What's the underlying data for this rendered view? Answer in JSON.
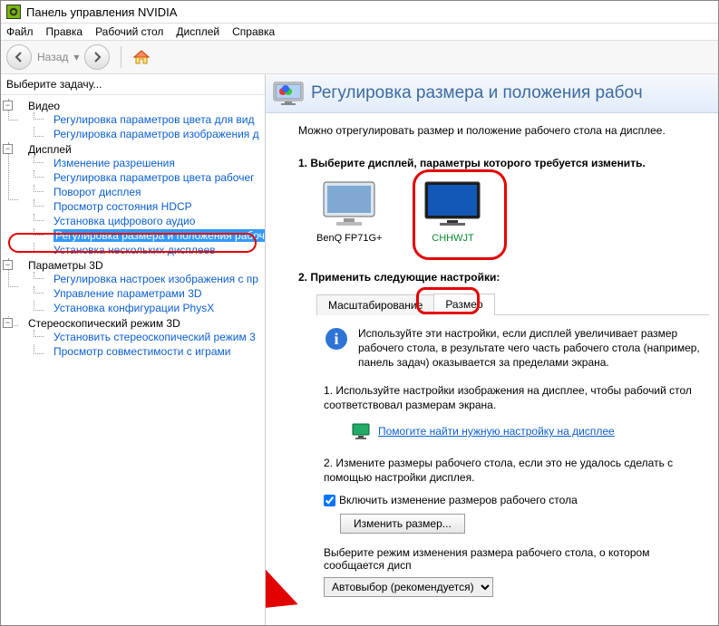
{
  "titlebar": {
    "title": "Панель управления NVIDIA"
  },
  "menu": {
    "file": "Файл",
    "edit": "Правка",
    "desktop": "Рабочий стол",
    "display": "Дисплей",
    "help": "Справка"
  },
  "toolbar": {
    "back": "Назад"
  },
  "sidebar": {
    "select_task": "Выберите задачу...",
    "video": {
      "label": "Видео",
      "items": [
        "Регулировка параметров цвета для вид",
        "Регулировка параметров изображения д"
      ]
    },
    "display": {
      "label": "Дисплей",
      "items": [
        "Изменение разрешения",
        "Регулировка параметров цвета рабочег",
        "Поворот дисплея",
        "Просмотр состояния HDCP",
        "Установка цифрового аудио",
        "Регулировка размера и положения рабоч",
        "Установка нескольких дисплеев"
      ]
    },
    "params3d": {
      "label": "Параметры 3D",
      "items": [
        "Регулировка настроек изображения с пр",
        "Управление параметрами 3D",
        "Установка конфигурации PhysX"
      ]
    },
    "stereo": {
      "label": "Стереоскопический режим 3D",
      "items": [
        "Установить стереоскопический режим 3",
        "Просмотр совместимости с играми"
      ]
    }
  },
  "page": {
    "title": "Регулировка размера и положения рабоч",
    "desc": "Можно отрегулировать размер и положение рабочего стола на дисплее.",
    "step1_title": "1. Выберите дисплей, параметры которого требуется изменить.",
    "displays": [
      {
        "name": "BenQ FP71G+",
        "selected": false
      },
      {
        "name": "CHHWJT",
        "selected": true
      }
    ],
    "step2_title": "2. Применить следующие настройки:",
    "tabs": {
      "scaling": "Масштабирование",
      "size": "Размер"
    },
    "info_text": "Используйте эти настройки, если дисплей увеличивает размер рабочего стола, в результате чего часть рабочего стола (например, панель задач) оказывается за пределами экрана.",
    "info_sub1": "1. Используйте настройки изображения на дисплее, чтобы рабочий стол соответствовал размерам экрана.",
    "help_link": "Помогите найти нужную настройку на дисплее",
    "info_sub2": "2. Измените размеры рабочего стола, если это не удалось сделать с помощью настройки дисплея.",
    "checkbox": "Включить изменение размеров рабочего стола",
    "resize_btn": "Изменить размер...",
    "mode_label": "Выберите режим изменения размера рабочего стола, о котором сообщается дисп",
    "mode_value": "Автовыбор (рекомендуется)"
  }
}
